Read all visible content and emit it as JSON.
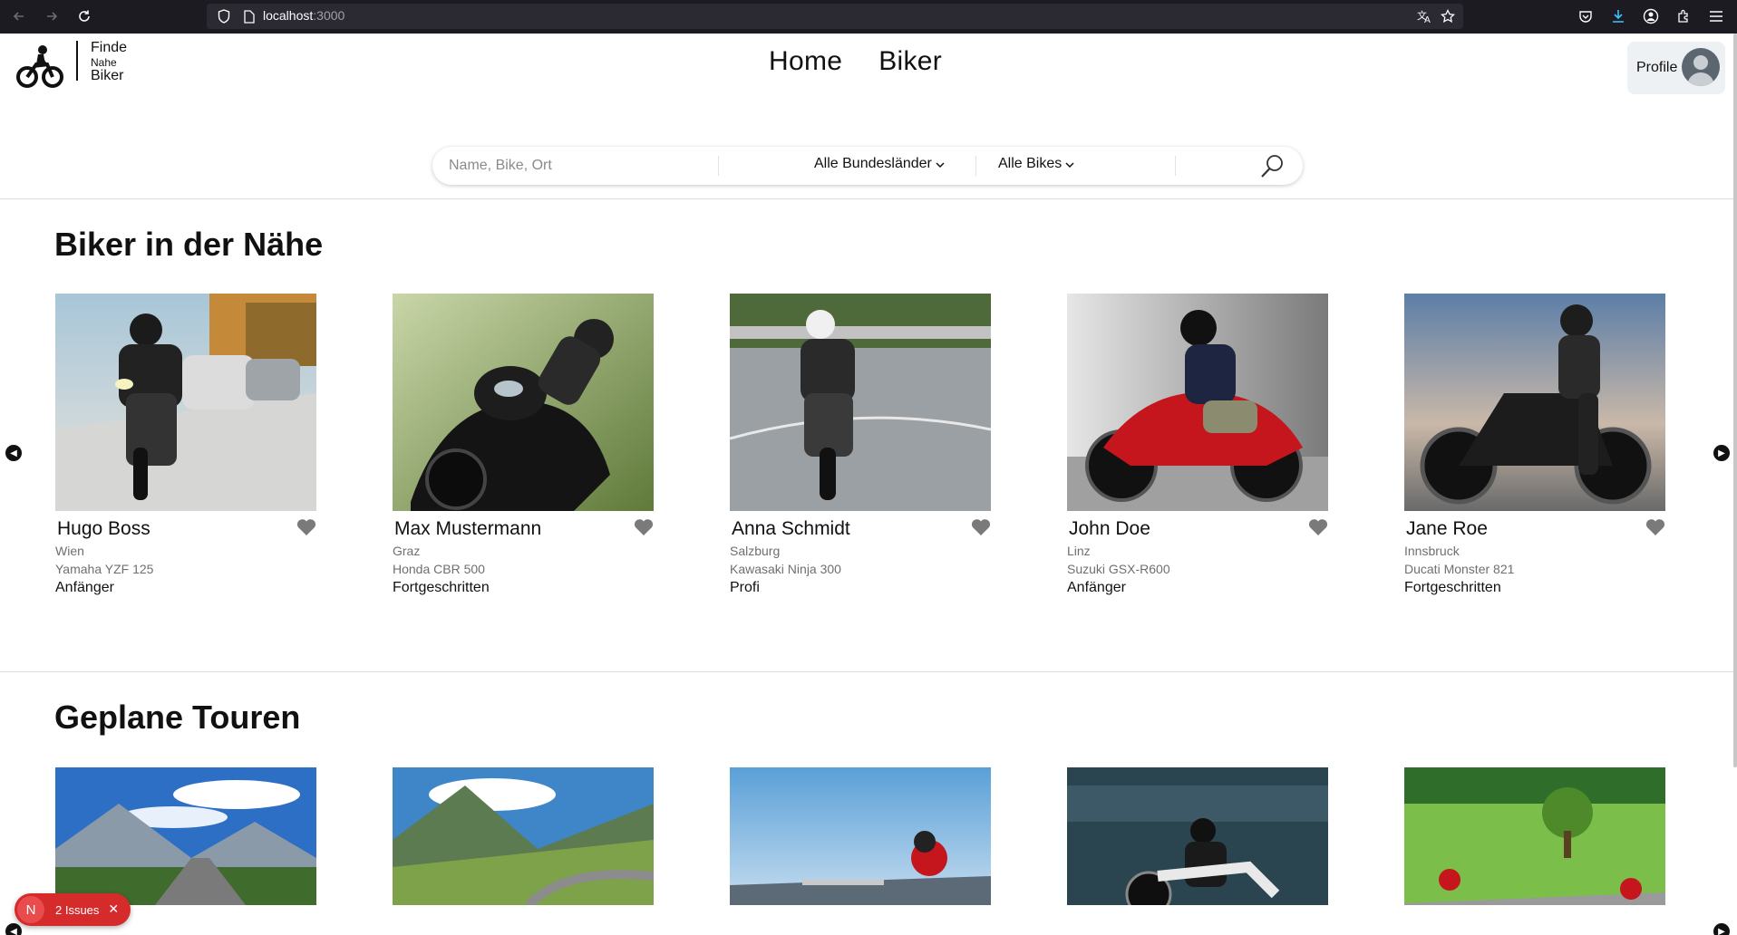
{
  "browser": {
    "url_host": "localhost",
    "url_port": ":3000",
    "icons": [
      "back-icon",
      "forward-icon",
      "reload-icon",
      "shield-icon",
      "page-icon",
      "translate-icon",
      "star-icon",
      "pocket-icon",
      "download-icon",
      "account-icon",
      "extensions-icon",
      "menu-icon"
    ]
  },
  "header": {
    "logo_line1": "Finde",
    "logo_line2": "Nahe",
    "logo_line3": "Biker",
    "nav": [
      "Home",
      "Biker"
    ],
    "profile_label": "Profile"
  },
  "search": {
    "placeholder": "Name, Bike, Ort",
    "region_label": "Alle Bundesländer",
    "bike_label": "Alle Bikes"
  },
  "nearby": {
    "title": "Biker in der Nähe",
    "bikers": [
      {
        "name": "Hugo Boss",
        "city": "Wien",
        "bike": "Yamaha YZF 125",
        "level": "Anfänger"
      },
      {
        "name": "Max Mustermann",
        "city": "Graz",
        "bike": "Honda CBR 500",
        "level": "Fortgeschritten"
      },
      {
        "name": "Anna Schmidt",
        "city": "Salzburg",
        "bike": "Kawasaki Ninja 300",
        "level": "Profi"
      },
      {
        "name": "John Doe",
        "city": "Linz",
        "bike": "Suzuki GSX-R600",
        "level": "Anfänger"
      },
      {
        "name": "Jane Roe",
        "city": "Innsbruck",
        "bike": "Ducati Monster 821",
        "level": "Fortgeschritten"
      }
    ]
  },
  "tours": {
    "title": "Geplane Touren"
  },
  "issues": {
    "badge_letter": "N",
    "label": "2 Issues",
    "close": "✕"
  },
  "colors": {
    "chrome_bg": "#1c1b22",
    "issues_red": "#d62b2b",
    "heart_gray": "#7a7a7a"
  }
}
